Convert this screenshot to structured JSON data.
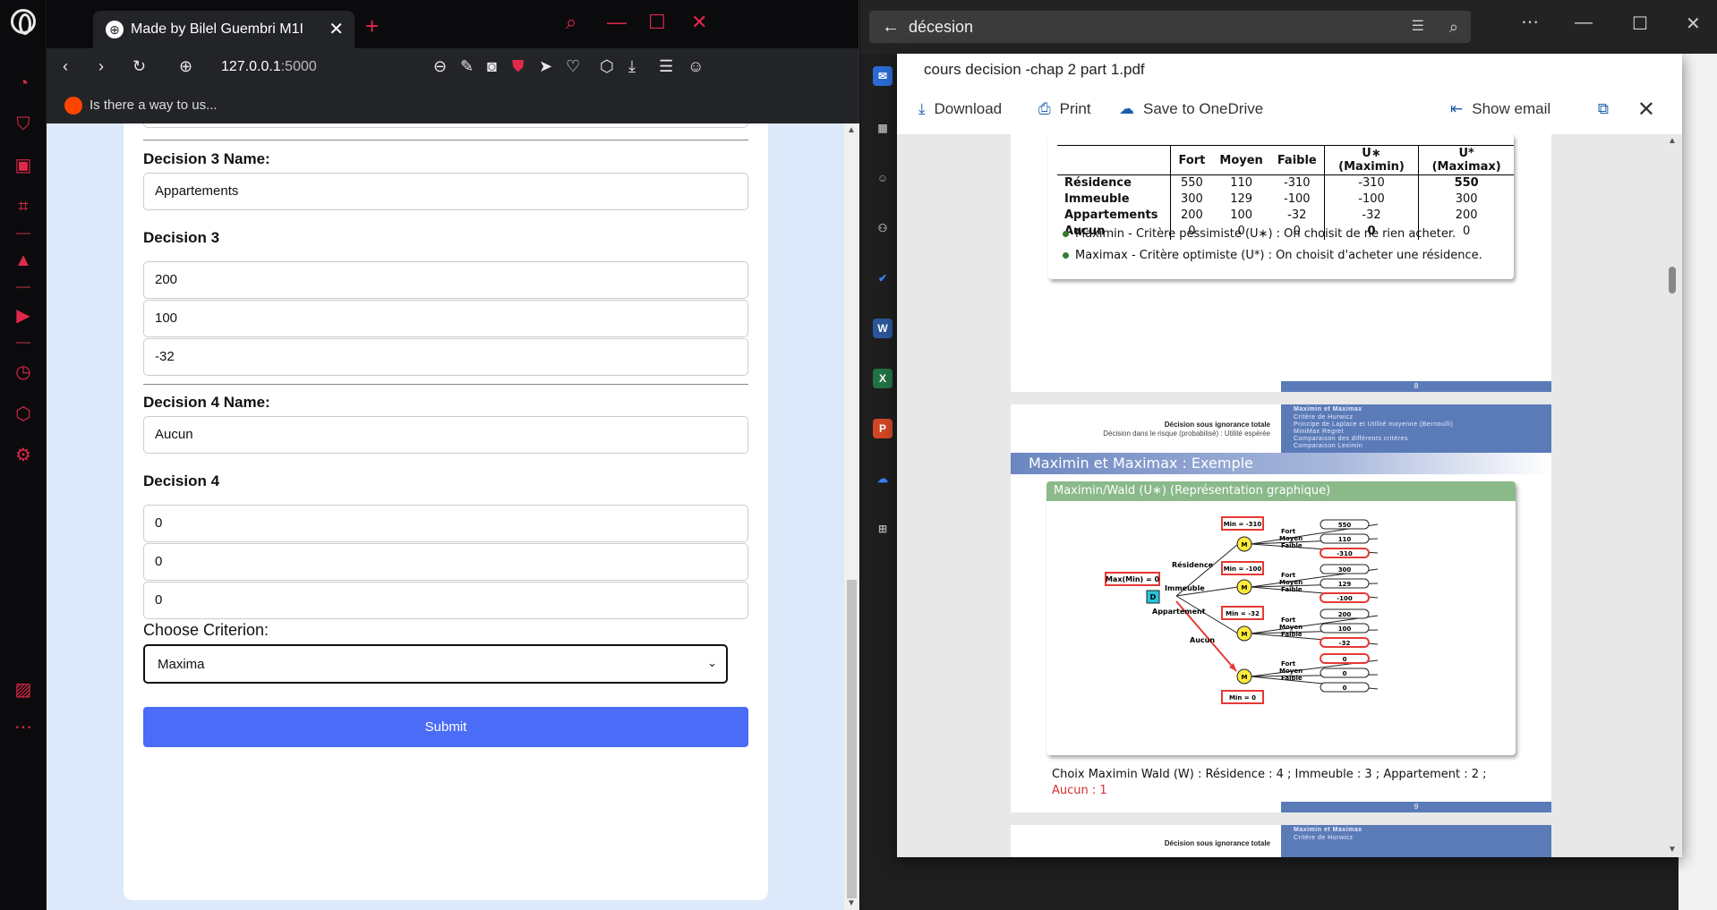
{
  "opera": {
    "tab_title": "Made by Bilel Guembri M1I",
    "url_host": "127.0.0.1",
    "url_port": ":5000",
    "bookmark": "Is there a way to us...",
    "form": {
      "d3_name_label": "Decision 3 Name:",
      "d3_name_value": "Appartements",
      "d3_label": "Decision 3",
      "d3_values": [
        "200",
        "100",
        "-32"
      ],
      "d4_name_label": "Decision 4 Name:",
      "d4_name_value": "Aucun",
      "d4_label": "Decision 4",
      "d4_values": [
        "0",
        "0",
        "0"
      ],
      "criterion_label": "Choose Criterion:",
      "criterion_value": "Maxima",
      "submit_label": "Submit"
    }
  },
  "outlook": {
    "search_value": "décesion"
  },
  "viewer": {
    "file_name": "cours decision -chap 2 part 1.pdf",
    "download": "Download",
    "print": "Print",
    "save_onedrive": "Save to OneDrive",
    "show_email": "Show email",
    "table": {
      "headers": [
        "",
        "Fort",
        "Moyen",
        "Faible",
        "U∗ (Maximin)",
        "U* (Maximax)"
      ],
      "rows": [
        [
          "Résidence",
          "550",
          "110",
          "-310",
          "-310",
          "550"
        ],
        [
          "Immeuble",
          "300",
          "129",
          "-100",
          "-100",
          "300"
        ],
        [
          "Appartements",
          "200",
          "100",
          "-32",
          "-32",
          "200"
        ],
        [
          "Aucun",
          "0",
          "0",
          "0",
          "0",
          "0"
        ]
      ]
    },
    "bullet1": "Maximin - Critère pessimiste (U∗) : On choisit de ne rien acheter.",
    "bullet2": "Maximax - Critère optimiste (U*) : On choisit d'acheter une résidence.",
    "slide8": "8",
    "header_left1": "Décision sous ignorance totale",
    "header_left2": "Décision dans le risque (probabilisé) : Utilité espérée",
    "header_right": [
      "Maximin et Maximax",
      "Critère de Hurwicz",
      "Principe de Laplace et Utilité moyenne (Bernoulli)",
      "MiniMax Regret",
      "Comparaison des différents critères",
      "Comparaison Leximin"
    ],
    "band_title": "Maximin et Maximax : Exemple",
    "graph_title": "Maximin/Wald (U∗) (Représentation graphique)",
    "tree": {
      "root": "Max(Min) = 0",
      "d": "D",
      "m": "M",
      "branches": [
        "Résidence",
        "Immeuble",
        "Appartement",
        "Aucun"
      ],
      "mins": [
        "Min = -310",
        "Min = -100",
        "Min = -32",
        "Min = 0"
      ],
      "states": [
        "Fort",
        "Moyen",
        "Faible"
      ],
      "leaves": [
        [
          "550",
          "110",
          "-310"
        ],
        [
          "300",
          "129",
          "-100"
        ],
        [
          "200",
          "100",
          "-32"
        ],
        [
          "0",
          "0",
          "0"
        ]
      ]
    },
    "caption": "Choix Maximin Wald (W) : Résidence : 4 ; Immeuble : 3 ; Appartement : 2 ;",
    "caption_red": "Aucun : 1",
    "slide9": "9",
    "next_left": "Décision sous ignorance totale",
    "next_right1": "Maximin et Maximax",
    "next_right2": "Critère de Hurwicz"
  }
}
